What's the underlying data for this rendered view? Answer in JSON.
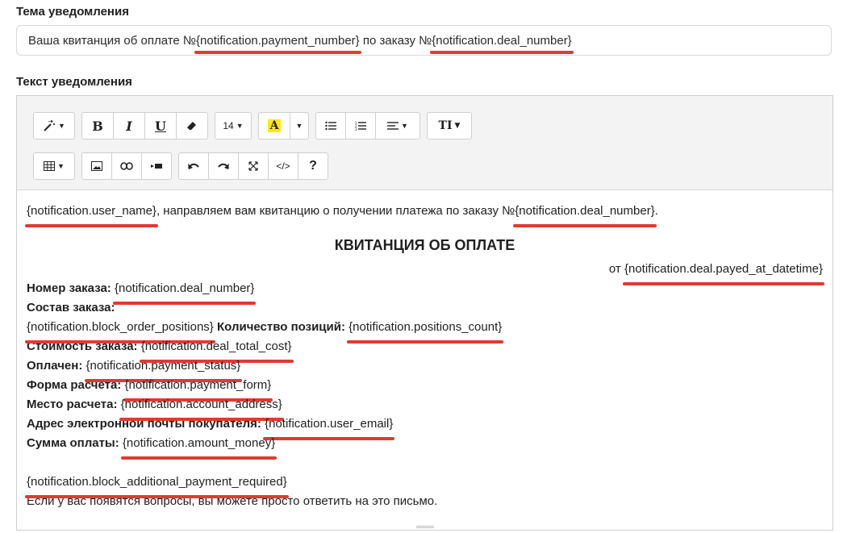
{
  "subject": {
    "label": "Тема уведомления",
    "prefix": "Ваша квитанция об оплате №",
    "var1": "{notification.payment_number}",
    "middle": " по заказу №",
    "var2": "{notification.deal_number}"
  },
  "body_label": "Текст уведомления",
  "toolbar": {
    "magic": "magic-wand-icon",
    "bold": "B",
    "italic": "I",
    "underline": "U",
    "eraser": "eraser-icon",
    "font_size": "14",
    "color": "A",
    "ul": "unordered-list-icon",
    "ol": "ordered-list-icon",
    "align": "align-icon",
    "text_style": "TI",
    "table": "table-icon",
    "image": "image-icon",
    "link": "link-icon",
    "video": "video-icon",
    "undo": "undo-icon",
    "redo": "redo-icon",
    "fullscreen": "fullscreen-icon",
    "code": "</>",
    "help": "?"
  },
  "content": {
    "greeting_var": "{notification.user_name}",
    "greeting_text": ", направляем вам квитанцию о получении платежа по заказу №",
    "greeting_deal": "{notification.deal_number}",
    "greeting_end": ".",
    "title": "КВИТАНЦИЯ ОБ ОПЛАТЕ",
    "from_label": "от ",
    "from_var": "{notification.deal.payed_at_datetime}",
    "order_no_label": "Номер заказа: ",
    "order_no_var": "{notification.deal_number}",
    "composition_label": "Состав заказа:",
    "positions_var": "{notification.block_order_positions}",
    "positions_count_label": " Количество позиций: ",
    "positions_count_var": "{notification.positions_count}",
    "cost_label": "Стоимость заказа: ",
    "cost_var": "{notification.deal_total_cost}",
    "paid_label": "Оплачен: ",
    "paid_var": "{notification.payment_status}",
    "form_label": "Форма расчета: ",
    "form_var": "{notification.payment_form}",
    "place_label": "Место расчета: ",
    "place_var": "{notification.account_address}",
    "email_label": "Адрес электронной почты покупателя: ",
    "email_var": "{notification.user_email}",
    "sum_label": "Сумма оплаты: ",
    "sum_var": "{notification.amount_money}",
    "additional_var": "{notification.block_additional_payment_required}",
    "footer": "Если у вас появятся вопросы, вы можете просто ответить на это письмо."
  },
  "colors": {
    "underline": "#e03a33",
    "highlight": "#ffea00"
  }
}
